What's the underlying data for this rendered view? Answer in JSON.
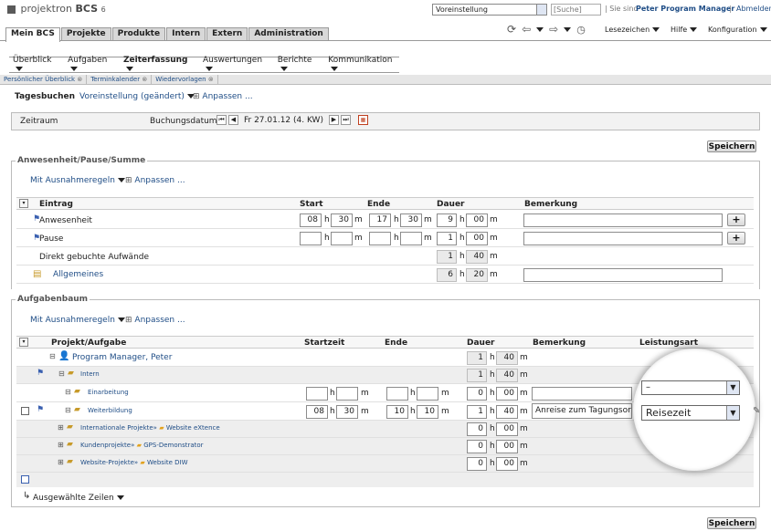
{
  "brand": {
    "name": "projektron",
    "product": "BCS",
    "version": "6"
  },
  "topbar": {
    "view_select": "Voreinstellung",
    "search_placeholder": "[Suche]",
    "you_are": "Sie sind",
    "user": "Peter Program Manager",
    "logout": "Abmelden"
  },
  "main_tabs": [
    "Mein BCS",
    "Projekte",
    "Produkte",
    "Intern",
    "Extern",
    "Administration"
  ],
  "toolbar": {
    "bookmarks": "Lesezeichen",
    "help": "Hilfe",
    "config": "Konfiguration"
  },
  "sub_nav": [
    "Überblick",
    "Aufgaben",
    "Zeiterfassung",
    "Auswertungen",
    "Berichte",
    "Kommunikation"
  ],
  "page_tabs": [
    "Persönlicher Überblick",
    "Terminkalender",
    "Wiedervorlagen"
  ],
  "page": {
    "title": "Tagesbuchen",
    "preset": "Voreinstellung (geändert)",
    "customize": "Anpassen ..."
  },
  "period": {
    "label": "Zeitraum",
    "booking_label": "Buchungsdatum:",
    "date": "Fr 27.01.12 (4. KW)"
  },
  "save": "Speichern",
  "attendance": {
    "title": "Anwesenheit/Pause/Summe",
    "rules": "Mit Ausnahmeregeln",
    "customize": "Anpassen ...",
    "cols": [
      "Eintrag",
      "Start",
      "Ende",
      "Dauer",
      "Bemerkung"
    ],
    "rows": [
      {
        "label": "Anwesenheit",
        "sh": "08",
        "sm": "30",
        "eh": "17",
        "em": "30",
        "dh": "9",
        "dm": "00"
      },
      {
        "label": "Pause",
        "sh": "",
        "sm": "",
        "eh": "",
        "em": "",
        "dh": "1",
        "dm": "00"
      },
      {
        "label": "Direkt gebuchte Aufwände",
        "dh": "1",
        "dm": "40"
      },
      {
        "label": "Allgemeines",
        "dh": "6",
        "dm": "20"
      }
    ]
  },
  "tasks": {
    "title": "Aufgabenbaum",
    "rules": "Mit Ausnahmeregeln",
    "customize": "Anpassen ...",
    "cols": [
      "Projekt/Aufgabe",
      "Startzeit",
      "Ende",
      "Dauer",
      "Bemerkung",
      "Leistungsart"
    ],
    "rows": [
      {
        "label": "Program Manager, Peter",
        "dh": "1",
        "dm": "40"
      },
      {
        "label": "Intern",
        "dh": "1",
        "dm": "40"
      },
      {
        "label": "Einarbeitung",
        "dh": "0",
        "dm": "00"
      },
      {
        "label": "Weiterbildung",
        "sh": "08",
        "sm": "30",
        "eh": "10",
        "em": "10",
        "dh": "1",
        "dm": "40",
        "note": "Anreise zum Tagungsort"
      },
      {
        "label": "Internationale Projekte",
        "sub": "Website eXtence",
        "dh": "0",
        "dm": "00"
      },
      {
        "label": "Kundenprojekte",
        "sub": "GPS-Demonstrator",
        "dh": "0",
        "dm": "00"
      },
      {
        "label": "Website-Projekte",
        "sub": "Website DIW",
        "dh": "0",
        "dm": "00"
      }
    ],
    "kind_options": [
      "–",
      "Reisezeit"
    ],
    "selected": "Ausgewählte Zeilen"
  },
  "units": {
    "h": "h",
    "m": "m"
  },
  "colors": {
    "active_tab": "#ffffff",
    "tab_bg": "#d8d8d8",
    "link": "#1f4d86"
  }
}
